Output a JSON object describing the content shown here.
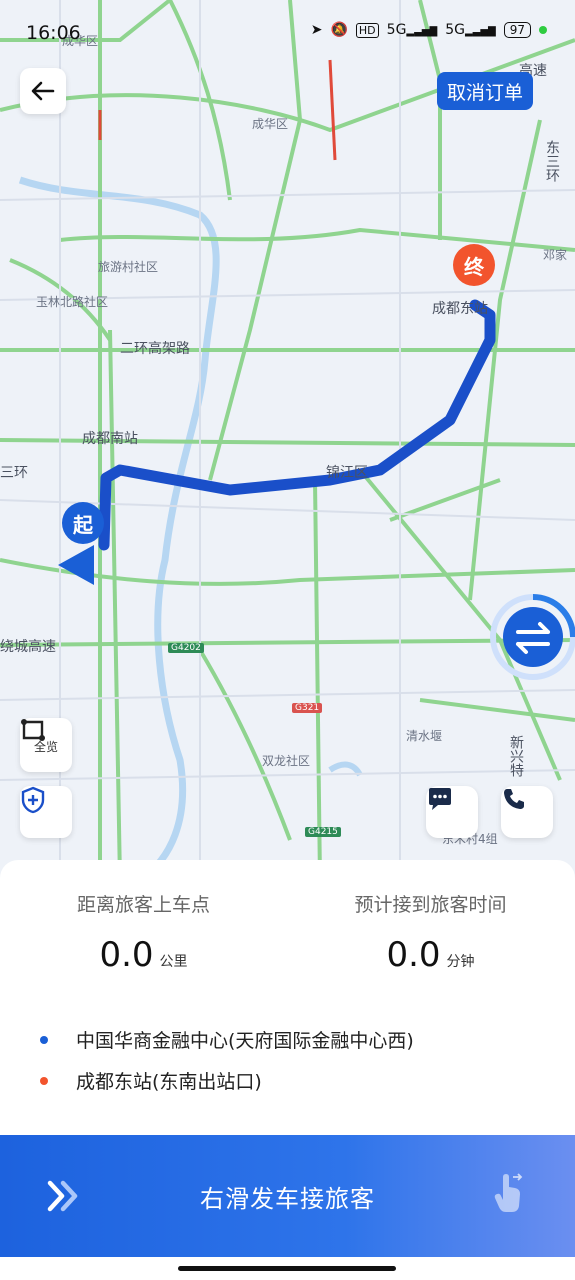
{
  "status_bar": {
    "time": "16:06",
    "icons": [
      "location-arrow-icon",
      "mute-bell-icon",
      "hd-icon",
      "5g-signal-icon",
      "5g-signal-icon"
    ],
    "hd": "HD",
    "net1": "5G",
    "net2": "5G",
    "battery": "97"
  },
  "header": {
    "cancel_label": "取消订单"
  },
  "map": {
    "labels": {
      "chenghua": "成华区",
      "lvyoucun": "旅游村社区",
      "yulinbeilu": "玉林北路社区",
      "erhuan": "二环高架路",
      "chengdunanzhan": "成都南站",
      "jinjiang": "锦江区",
      "sanhuan": "三环",
      "chengdudongzhan": "成都东站",
      "shuanglong": "双龙社区",
      "qingshuiyan": "清水堰",
      "dongsancun": "东三环",
      "xinxingte": "新兴特",
      "jiakemu": "邓家",
      "gaosu": "高速",
      "raocheng": "绕城高速",
      "dongsi": "东禾村4组"
    },
    "shields": {
      "g4202": "G4202",
      "g321": "G321",
      "g4215": "G4215"
    },
    "start_marker": "起",
    "end_marker": "终",
    "overview_label": "全览"
  },
  "metrics": {
    "distance_title": "距离旅客上车点",
    "distance_value": "0.0",
    "distance_unit": "公里",
    "time_title": "预计接到旅客时间",
    "time_value": "0.0",
    "time_unit": "分钟"
  },
  "route": {
    "pickup": "中国华商金融中心(天府国际金融中心西)",
    "pickup_color": "#1a5fd6",
    "destination": "成都东站(东南出站口)",
    "destination_color": "#f2542d"
  },
  "slide": {
    "label": "右滑发车接旅客"
  },
  "colors": {
    "accent": "#1a5fd6",
    "route": "#1a4fc9",
    "road_green": "#7fd07f",
    "end": "#f2542d"
  }
}
